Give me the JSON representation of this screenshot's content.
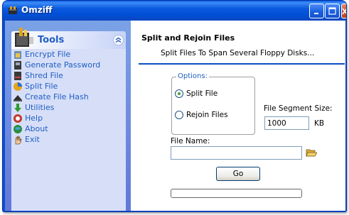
{
  "window": {
    "title": "Omziff"
  },
  "sidebar": {
    "header_label": "Tools",
    "items": [
      {
        "label": "Encrypt File",
        "icon": "encrypt-icon"
      },
      {
        "label": "Generate Password",
        "icon": "password-icon"
      },
      {
        "label": "Shred File",
        "icon": "shred-icon"
      },
      {
        "label": "Split File",
        "icon": "split-icon"
      },
      {
        "label": "Create File Hash",
        "icon": "hash-icon"
      },
      {
        "label": "Utilities",
        "icon": "utilities-icon"
      },
      {
        "label": "Help",
        "icon": "help-icon"
      },
      {
        "label": "About",
        "icon": "about-icon"
      },
      {
        "label": "Exit",
        "icon": "exit-icon"
      }
    ]
  },
  "main": {
    "title": "Split and Rejoin Files",
    "subtitle": "Split Files To Span Several Floppy Disks...",
    "options": {
      "legend": "Options:",
      "split_label": "Split File",
      "rejoin_label": "Rejoin Files",
      "selected": "split"
    },
    "segment": {
      "label": "File Segment Size:",
      "value": "1000",
      "unit": "KB"
    },
    "file_name": {
      "label": "File Name:",
      "value": ""
    },
    "go_label": "Go",
    "progress": 0
  },
  "colors": {
    "accent": "#0a4fd4",
    "sidebar_link": "#215dc6",
    "separator": "#0c4fc4"
  }
}
